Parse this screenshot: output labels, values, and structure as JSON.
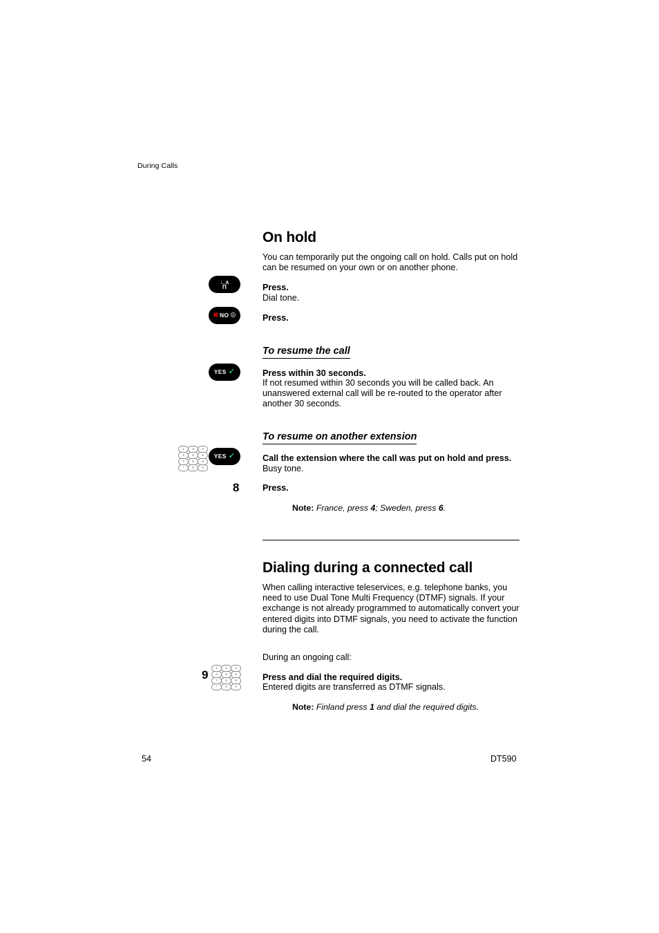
{
  "header": {
    "running_head": "During Calls"
  },
  "footer": {
    "page_number": "54",
    "model": "DT590"
  },
  "sections": [
    {
      "title": "On hold",
      "intro": "You can temporarily put the ongoing call on hold. Calls put on hold can be resumed on your own or on another phone.",
      "steps": [
        {
          "icon": "r-key-icon",
          "icon_label": "R",
          "lead": "Press.",
          "desc": "Dial tone."
        },
        {
          "icon": "no-key-icon",
          "icon_label": "NO",
          "lead": "Press.",
          "desc": ""
        }
      ],
      "subsections": [
        {
          "title": "To resume the call",
          "icon": "yes-key-icon",
          "icon_label": "YES",
          "lead": "Press within 30 seconds.",
          "desc": "If not resumed within 30 seconds you will be called back. An unanswered external call will be re-routed to the operator after another 30 seconds."
        },
        {
          "title": "To resume on another extension",
          "icon": "keypad-icon",
          "icon_label2": "YES",
          "lead": "Call the extension where the call was put on hold and press.",
          "desc": "Busy tone.",
          "digit": "8",
          "digit_lead": "Press.",
          "note_label": "Note:",
          "note_text_a": "France, press ",
          "note_num_a": "4",
          "note_text_b": "; Sweden, press ",
          "note_num_b": "6",
          "note_text_c": "."
        }
      ]
    },
    {
      "title": "Dialing during a connected call",
      "intro": "When calling interactive teleservices, e.g. telephone banks, you need to use Dual Tone Multi Frequency (DTMF) signals. If your exchange is not already programmed to automatically convert your entered digits into DTMF signals, you need to activate the function during the call.",
      "during_label": "During an ongoing call:",
      "digit": "9",
      "lead": "Press and dial the required digits.",
      "desc": "Entered digits are transferred as DTMF signals.",
      "note_label": "Note:",
      "note_text_a": "Finland press ",
      "note_num_a": "1",
      "note_text_b": " and dial the required digits."
    }
  ],
  "keypad": {
    "keys": [
      "1",
      "2",
      "3",
      "4",
      "5",
      "6",
      "7",
      "8",
      "9",
      "*",
      "0",
      "#"
    ]
  }
}
